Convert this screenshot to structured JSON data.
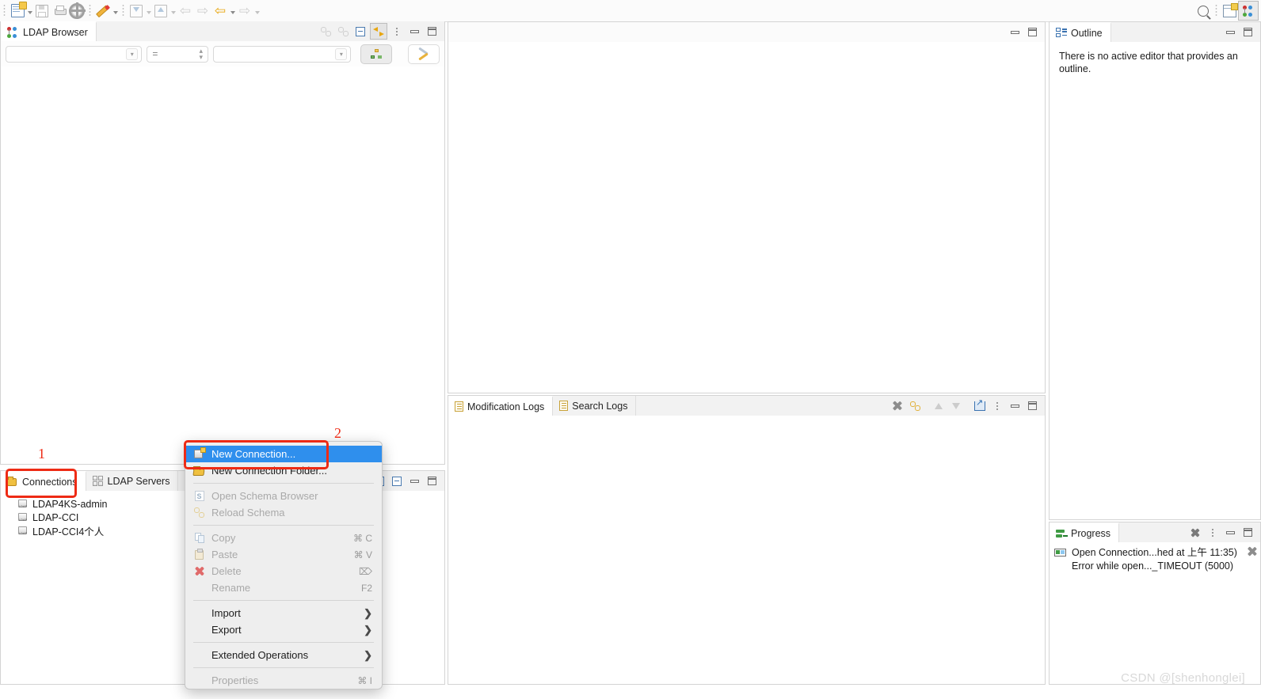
{
  "toolbar": {
    "buttons": [
      {
        "name": "new-document",
        "icon": "new-document-icon",
        "has_dropdown": true,
        "enabled": true
      },
      {
        "name": "save",
        "icon": "save-icon",
        "has_dropdown": false,
        "enabled": false
      },
      {
        "name": "print",
        "icon": "print-icon",
        "has_dropdown": false,
        "enabled": false
      },
      {
        "name": "preferences",
        "icon": "gear-icon",
        "has_dropdown": false,
        "enabled": true
      },
      {
        "name": "quick-access",
        "icon": "wand-icon",
        "has_dropdown": true,
        "enabled": true
      },
      {
        "name": "import",
        "icon": "import-icon",
        "has_dropdown": true,
        "enabled": false
      },
      {
        "name": "export",
        "icon": "export-icon",
        "has_dropdown": true,
        "enabled": false
      },
      {
        "name": "back",
        "icon": "arrow-left-icon",
        "has_dropdown": false,
        "enabled": false
      },
      {
        "name": "forward",
        "icon": "arrow-right-icon",
        "has_dropdown": false,
        "enabled": false
      },
      {
        "name": "previous",
        "icon": "arrow-left-amber-icon",
        "has_dropdown": true,
        "enabled": true
      },
      {
        "name": "next",
        "icon": "arrow-right-grey-icon",
        "has_dropdown": true,
        "enabled": false
      }
    ],
    "search_icon": "search-icon",
    "perspective_open_icon": "open-perspective-icon",
    "perspective_active_icon": "ldap-browser-perspective-icon"
  },
  "ldap_browser": {
    "tab_label": "LDAP Browser",
    "tab_icon": "ldap-browser-icon",
    "tools": [
      {
        "name": "refresh-tool",
        "icon": "refresh-icon",
        "enabled": false
      },
      {
        "name": "link-tool",
        "icon": "chain-icon",
        "enabled": false
      },
      {
        "name": "collapse-all-tool",
        "icon": "collapse-all-icon",
        "enabled": true
      },
      {
        "name": "link-with-editor-tool",
        "icon": "link-arrows-icon",
        "enabled": true,
        "pressed": true
      },
      {
        "name": "view-menu",
        "icon": "vertical-dots-icon",
        "enabled": true
      },
      {
        "name": "minimize",
        "icon": "minimize-icon",
        "enabled": true
      },
      {
        "name": "maximize",
        "icon": "maximize-icon",
        "enabled": true
      }
    ],
    "filter": {
      "attribute_value": "",
      "operator_value": "=",
      "term_value": "",
      "hierarchy_button_icon": "hierarchy-icon",
      "tools_button_icon": "tools-icon"
    }
  },
  "editor_area": {
    "tools": [
      {
        "name": "minimize",
        "icon": "minimize-icon"
      },
      {
        "name": "maximize",
        "icon": "maximize-icon"
      }
    ]
  },
  "logs_panel": {
    "tabs": [
      {
        "label": "Modification Logs",
        "icon": "log-document-icon",
        "active": true
      },
      {
        "label": "Search Logs",
        "icon": "log-document-icon",
        "active": false
      }
    ],
    "tools": [
      {
        "name": "clear-tool",
        "icon": "clear-x-icon",
        "enabled": true
      },
      {
        "name": "refresh-tool",
        "icon": "chain-icon",
        "enabled": true
      },
      {
        "name": "older-tool",
        "icon": "arrow-up-icon",
        "enabled": false
      },
      {
        "name": "newer-tool",
        "icon": "arrow-down-icon",
        "enabled": false
      },
      {
        "name": "export-tool",
        "icon": "open-export-icon",
        "enabled": true
      },
      {
        "name": "view-menu",
        "icon": "vertical-dots-icon",
        "enabled": true
      },
      {
        "name": "minimize",
        "icon": "minimize-icon",
        "enabled": true
      },
      {
        "name": "maximize",
        "icon": "maximize-icon",
        "enabled": true
      }
    ]
  },
  "connections_panel": {
    "tabs": [
      {
        "label": "Connections",
        "icon": "connections-folder-icon",
        "active": true
      },
      {
        "label": "LDAP Servers",
        "icon": "ldap-servers-icon",
        "active": false
      }
    ],
    "tools": [
      {
        "name": "new-connection-tool",
        "icon": "new-connection-icon"
      },
      {
        "name": "collapse-all-tool",
        "icon": "collapse-all-icon"
      },
      {
        "name": "minimize",
        "icon": "minimize-icon"
      },
      {
        "name": "maximize",
        "icon": "maximize-icon"
      }
    ],
    "items": [
      {
        "label": "LDAP4KS-admin",
        "icon": "connection-icon"
      },
      {
        "label": "LDAP-CCI",
        "icon": "connection-icon"
      },
      {
        "label": "LDAP-CCI4个人",
        "icon": "connection-icon"
      }
    ]
  },
  "outline_panel": {
    "tab_label": "Outline",
    "tab_icon": "outline-icon",
    "message": "There is no active editor that provides an outline.",
    "tools": [
      {
        "name": "minimize",
        "icon": "minimize-icon"
      },
      {
        "name": "maximize",
        "icon": "maximize-icon"
      }
    ]
  },
  "progress_panel": {
    "tab_label": "Progress",
    "tab_icon": "progress-icon",
    "tools": [
      {
        "name": "stop-all-tool",
        "icon": "stop-icon"
      },
      {
        "name": "view-menu",
        "icon": "vertical-dots-icon"
      },
      {
        "name": "minimize",
        "icon": "minimize-icon"
      },
      {
        "name": "maximize",
        "icon": "maximize-icon"
      }
    ],
    "entry": {
      "icon": "progress-item-icon",
      "line1": "Open Connection...hed at 上午 11:35)",
      "line2": "Error while open..._TIMEOUT (5000)",
      "cancel_icon": "cancel-x-icon"
    }
  },
  "context_menu": {
    "items": [
      {
        "label": "New Connection...",
        "icon": "new-connection-icon",
        "accel": "",
        "submenu": false,
        "disabled": false,
        "highlighted": true
      },
      {
        "label": "New Connection Folder...",
        "icon": "new-folder-icon",
        "accel": "",
        "submenu": false,
        "disabled": false,
        "highlighted": false
      },
      {
        "separator": true
      },
      {
        "label": "Open Schema Browser",
        "icon": "schema-icon",
        "accel": "",
        "submenu": false,
        "disabled": true,
        "highlighted": false
      },
      {
        "label": "Reload Schema",
        "icon": "reload-icon",
        "accel": "",
        "submenu": false,
        "disabled": true,
        "highlighted": false
      },
      {
        "separator": true
      },
      {
        "label": "Copy",
        "icon": "copy-icon",
        "accel": "⌘ C",
        "submenu": false,
        "disabled": true,
        "highlighted": false
      },
      {
        "label": "Paste",
        "icon": "paste-icon",
        "accel": "⌘ V",
        "submenu": false,
        "disabled": true,
        "highlighted": false
      },
      {
        "label": "Delete",
        "icon": "delete-icon",
        "accel": "⌦",
        "submenu": false,
        "disabled": true,
        "highlighted": false
      },
      {
        "label": "Rename",
        "icon": "",
        "accel": "F2",
        "submenu": false,
        "disabled": true,
        "highlighted": false
      },
      {
        "separator": true
      },
      {
        "label": "Import",
        "icon": "",
        "accel": "",
        "submenu": true,
        "disabled": false,
        "highlighted": false
      },
      {
        "label": "Export",
        "icon": "",
        "accel": "",
        "submenu": true,
        "disabled": false,
        "highlighted": false
      },
      {
        "separator": true
      },
      {
        "label": "Extended Operations",
        "icon": "",
        "accel": "",
        "submenu": true,
        "disabled": false,
        "highlighted": false
      },
      {
        "separator": true
      },
      {
        "label": "Properties",
        "icon": "",
        "accel": "⌘ I",
        "submenu": false,
        "disabled": true,
        "highlighted": false
      }
    ]
  },
  "annotations": [
    {
      "number": "1",
      "target": "connections-tab"
    },
    {
      "number": "2",
      "target": "new-connection-menu-item"
    }
  ],
  "watermark": "CSDN @[shenhonglei]",
  "colors": {
    "menu_highlight": "#2f8fed",
    "annotation_red": "#ee2b15",
    "panel_tab_bg": "#f2f2f2",
    "toolbar_bg": "#fbfbfb",
    "amber": "#e8a60f"
  }
}
